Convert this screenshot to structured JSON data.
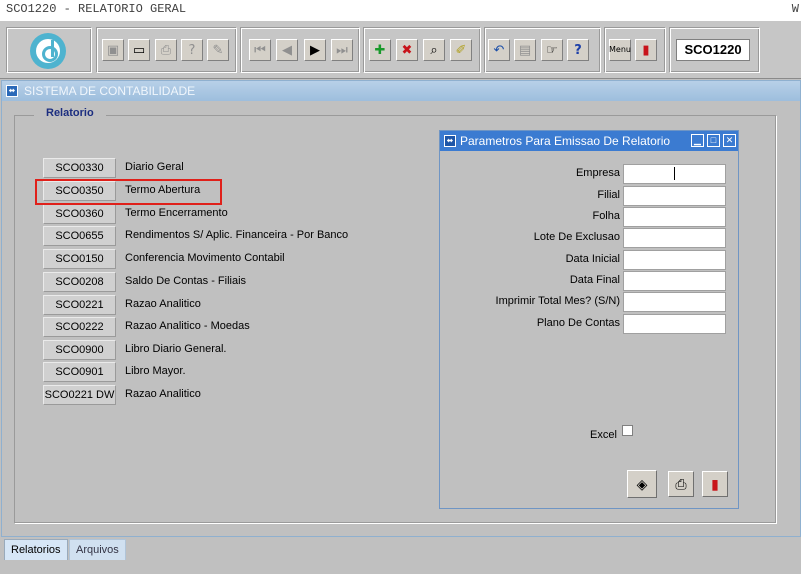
{
  "window": {
    "title": "SCO1220 - RELATORIO GERAL",
    "right_letter": "W"
  },
  "toolbar": {
    "form_code": "SCO1220",
    "icons": [
      "save-icon",
      "screen-icon",
      "print-icon",
      "query-help-icon",
      "wizard-icon",
      "first-record-icon",
      "previous-record-icon",
      "next-record-icon",
      "last-record-icon",
      "insert-icon",
      "delete-icon",
      "search-icon",
      "clear-icon",
      "undo-icon",
      "clipboard-icon",
      "hand-icon",
      "help-icon",
      "menu-icon",
      "exit-icon"
    ],
    "menu_label": "Menu"
  },
  "main": {
    "title": "SISTEMA DE CONTABILIDADE",
    "panel_label": "Relatorio",
    "reports": [
      {
        "code": "SCO0330",
        "desc": "Diario Geral"
      },
      {
        "code": "SCO0350",
        "desc": "Termo Abertura"
      },
      {
        "code": "SCO0360",
        "desc": "Termo Encerramento"
      },
      {
        "code": "SCO0655",
        "desc": "Rendimentos S/ Aplic. Financeira - Por Banco"
      },
      {
        "code": "SCO0150",
        "desc": "Conferencia Movimento Contabil"
      },
      {
        "code": "SCO0208",
        "desc": "Saldo De Contas - Filiais"
      },
      {
        "code": "SCO0221",
        "desc": "Razao Analitico"
      },
      {
        "code": "SCO0222",
        "desc": "Razao Analitico - Moedas"
      },
      {
        "code": "SCO0900",
        "desc": "Libro Diario General."
      },
      {
        "code": "SCO0901",
        "desc": "Libro Mayor."
      },
      {
        "code": "SCO0221 DW",
        "desc": "Razao Analitico"
      }
    ]
  },
  "params": {
    "title": "Parametros Para Emissao De Relatorio",
    "fields": [
      {
        "label": "Empresa",
        "value": ""
      },
      {
        "label": "Filial",
        "value": ""
      },
      {
        "label": "Folha",
        "value": ""
      },
      {
        "label": "Lote De Exclusao",
        "value": ""
      },
      {
        "label": "Data Inicial",
        "value": ""
      },
      {
        "label": "Data Final",
        "value": ""
      },
      {
        "label": "Imprimir Total Mes? (S/N)",
        "value": ""
      },
      {
        "label": "Plano De Contas",
        "value": ""
      }
    ],
    "excel_label": "Excel"
  },
  "tabs": [
    {
      "label": "Relatorios",
      "active": true
    },
    {
      "label": "Arquivos",
      "active": false
    }
  ],
  "colors": {
    "highlight": "#e0201a",
    "accent": "#3b7bd1",
    "panel_label": "#1c2e80"
  }
}
